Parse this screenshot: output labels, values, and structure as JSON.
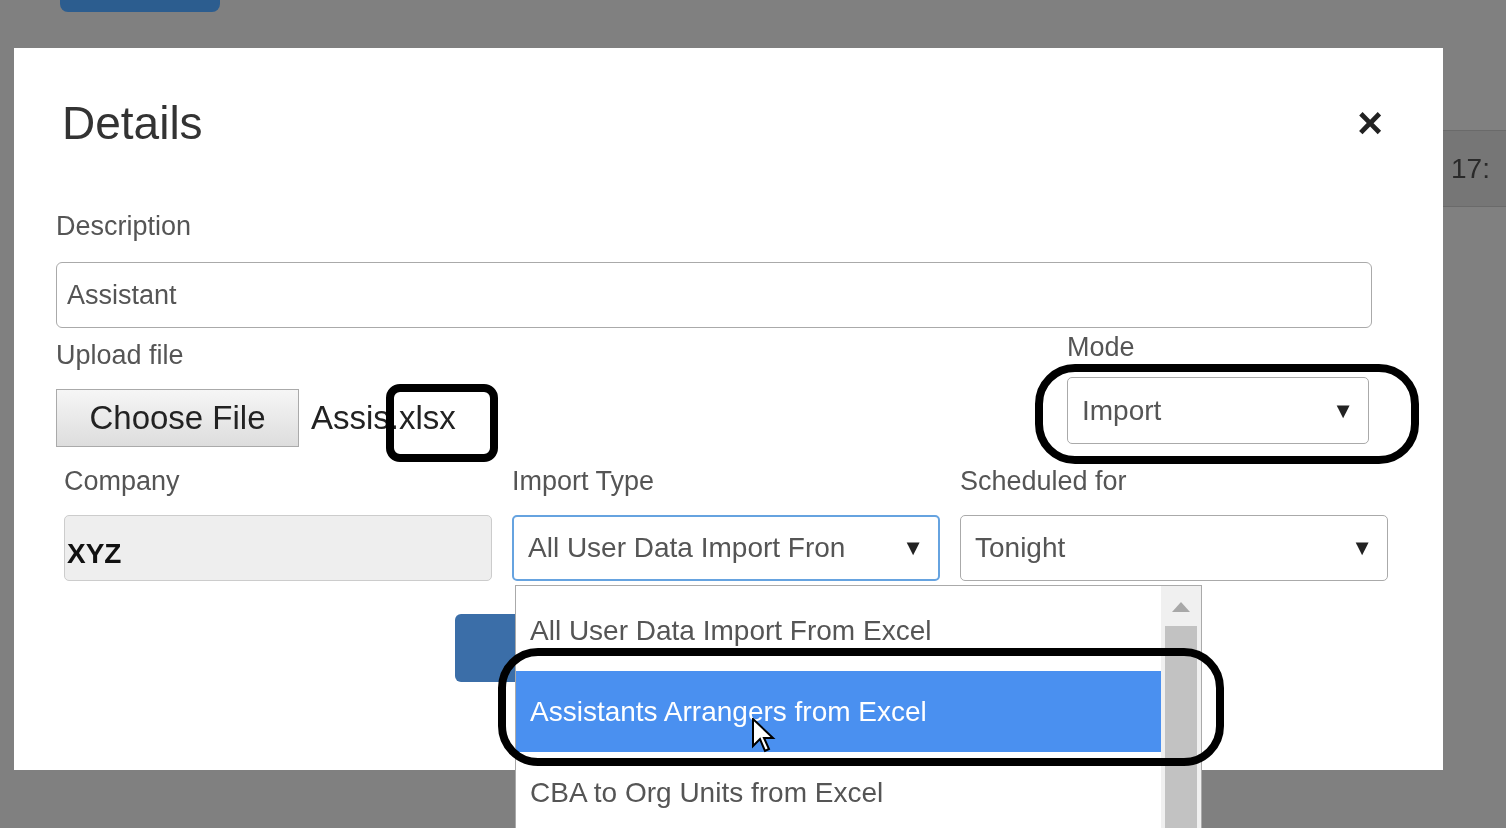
{
  "background": {
    "time_cell": "17:"
  },
  "dialog": {
    "title": "Details",
    "close": "×",
    "description": {
      "label": "Description",
      "value": "Assistant"
    },
    "upload": {
      "label": "Upload file",
      "button": "Choose File",
      "file_name": "Assis.xlsx"
    },
    "mode": {
      "label": "Mode",
      "value": "Import",
      "arrow": "▼"
    },
    "company": {
      "label": "Company",
      "value": "XYZ",
      "disabled": true
    },
    "import_type": {
      "label": "Import Type",
      "value": "All User Data Import Fron",
      "arrow": "▼",
      "expanded": true,
      "options": [
        {
          "label": "All User Data Import From Excel",
          "selected": false
        },
        {
          "label": "Assistants Arrangers from Excel",
          "selected": true
        },
        {
          "label": "CBA to Org Units from Excel",
          "selected": false
        }
      ]
    },
    "scheduled": {
      "label": "Scheduled for",
      "value": "Tonight",
      "arrow": "▼"
    }
  }
}
